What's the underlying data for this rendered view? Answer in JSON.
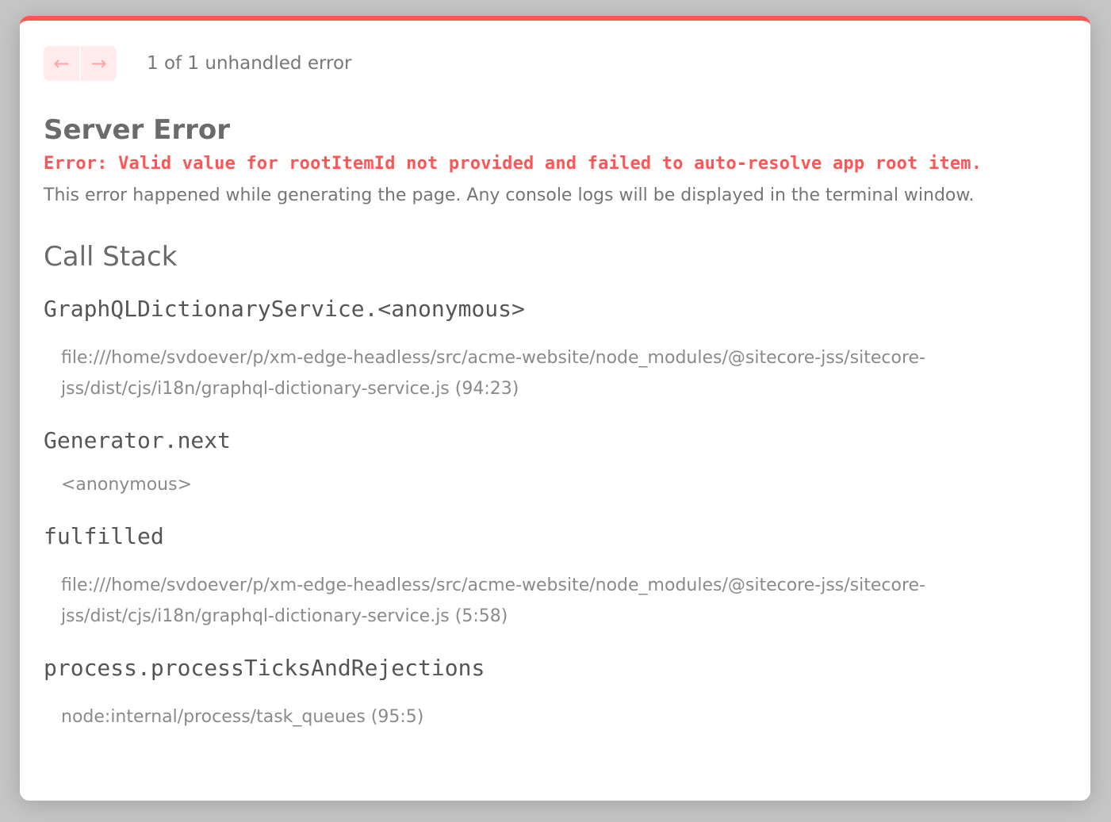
{
  "nav": {
    "prev_icon": "arrow-left-icon",
    "next_icon": "arrow-right-icon",
    "prev": "←",
    "next": "→",
    "count": "1 of 1 unhandled error"
  },
  "title": "Server Error",
  "error_message": "Error: Valid value for rootItemId not provided and failed to auto-resolve app root item.",
  "description": "This error happened while generating the page. Any console logs will be displayed in the terminal window.",
  "call_stack_title": "Call Stack",
  "frames": [
    {
      "fn": "GraphQLDictionaryService.<anonymous>",
      "loc": "file:///home/svdoever/p/xm-edge-headless/src/acme-website/node_modules/@sitecore-jss/sitecore-jss/dist/cjs/i18n/graphql-dictionary-service.js (94:23)"
    },
    {
      "fn": "Generator.next",
      "loc": "<anonymous>"
    },
    {
      "fn": "fulfilled",
      "loc": "file:///home/svdoever/p/xm-edge-headless/src/acme-website/node_modules/@sitecore-jss/sitecore-jss/dist/cjs/i18n/graphql-dictionary-service.js (5:58)"
    },
    {
      "fn": "process.processTicksAndRejections",
      "loc": "node:internal/process/task_queues (95:5)"
    }
  ],
  "colors": {
    "accent": "#ff5555",
    "nav_bg": "#ffebeb"
  }
}
